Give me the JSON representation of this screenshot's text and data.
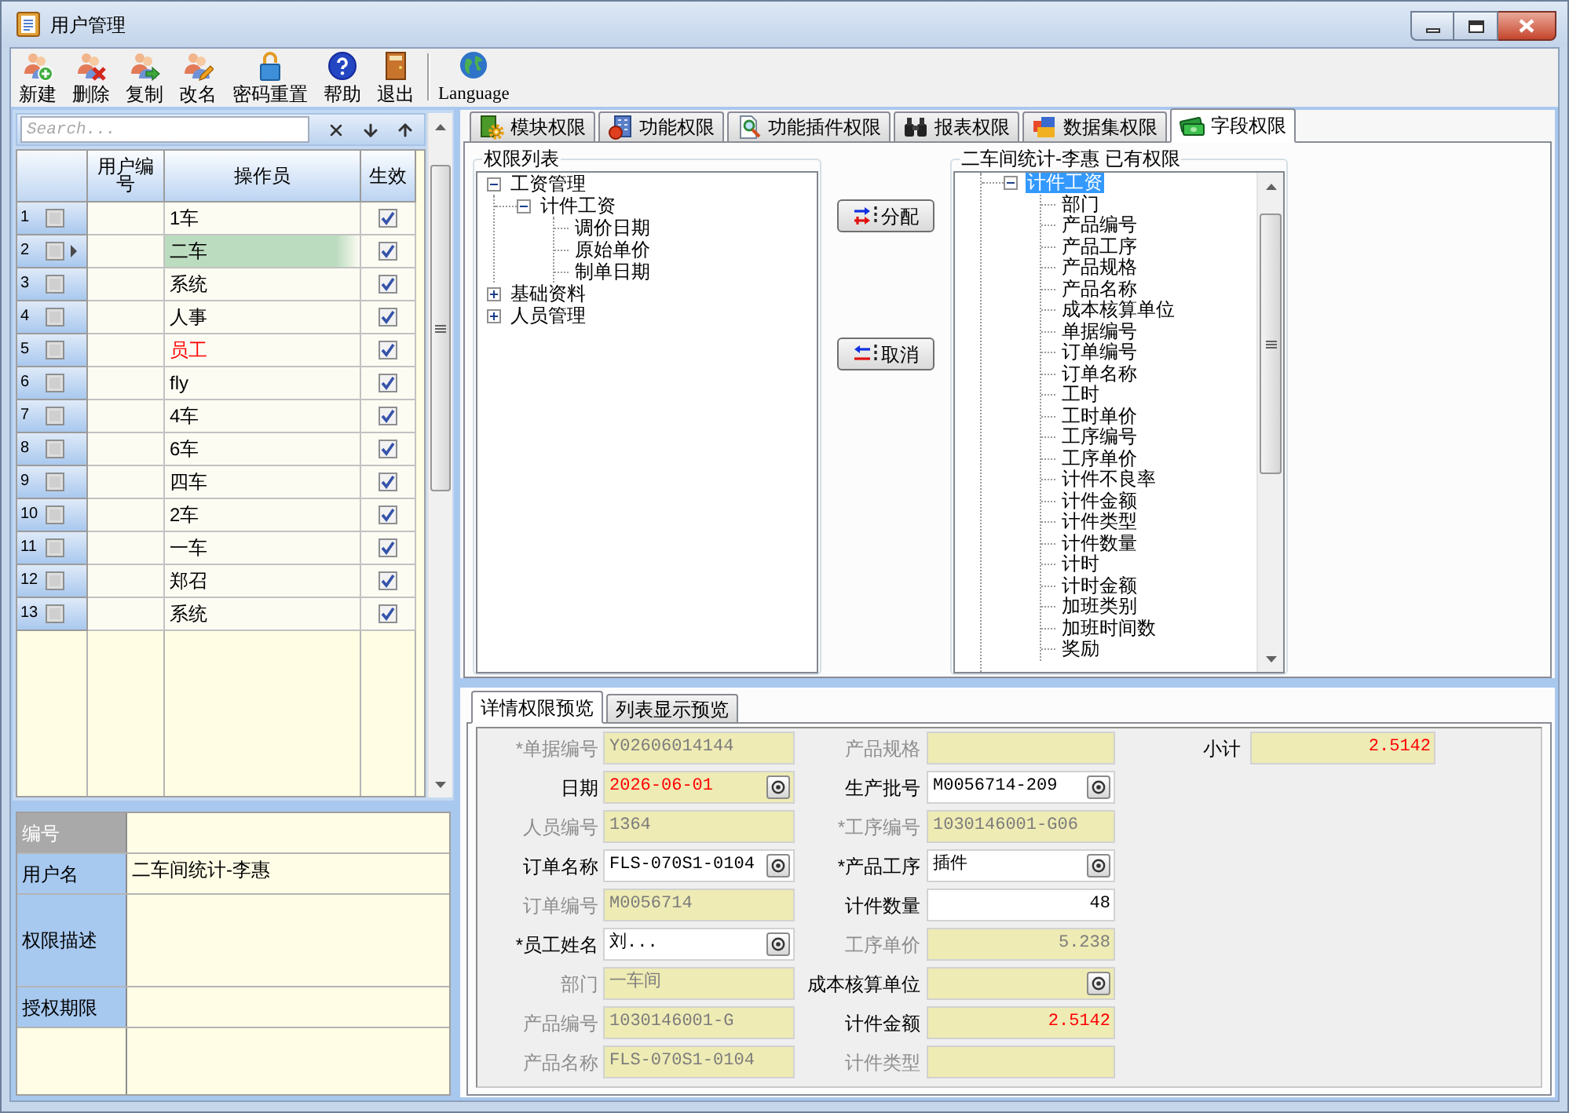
{
  "window": {
    "title": "用户管理"
  },
  "toolbar": {
    "buttons": [
      {
        "label": "新建"
      },
      {
        "label": "删除"
      },
      {
        "label": "复制"
      },
      {
        "label": "改名"
      },
      {
        "label": "密码重置"
      },
      {
        "label": "帮助"
      },
      {
        "label": "退出"
      }
    ],
    "language": {
      "label": "Language"
    }
  },
  "user_list": {
    "search": {
      "placeholder": "Search..."
    },
    "columns": [
      {
        "label": "用户编号"
      },
      {
        "label": "操作员"
      },
      {
        "label": "生效"
      }
    ],
    "rows": [
      {
        "number": "1",
        "checked": false,
        "selected": false,
        "operator": "1车",
        "flagged": false,
        "active": true
      },
      {
        "number": "2",
        "checked": false,
        "selected": true,
        "operator": "二车",
        "flagged": false,
        "active": true
      },
      {
        "number": "3",
        "checked": false,
        "selected": false,
        "operator": "系统",
        "flagged": false,
        "active": true
      },
      {
        "number": "4",
        "checked": false,
        "selected": false,
        "operator": "人事",
        "flagged": false,
        "active": true
      },
      {
        "number": "5",
        "checked": false,
        "selected": false,
        "operator": "员工",
        "flagged": true,
        "active": true
      },
      {
        "number": "6",
        "checked": false,
        "selected": false,
        "operator": "fly",
        "flagged": false,
        "active": true
      },
      {
        "number": "7",
        "checked": false,
        "selected": false,
        "operator": "4车",
        "flagged": false,
        "active": true
      },
      {
        "number": "8",
        "checked": false,
        "selected": false,
        "operator": "6车",
        "flagged": false,
        "active": true
      },
      {
        "number": "9",
        "checked": false,
        "selected": false,
        "operator": "四车",
        "flagged": false,
        "active": true
      },
      {
        "number": "10",
        "checked": false,
        "selected": false,
        "operator": "2车",
        "flagged": false,
        "active": true
      },
      {
        "number": "11",
        "checked": false,
        "selected": false,
        "operator": "一车",
        "flagged": false,
        "active": true
      },
      {
        "number": "12",
        "checked": false,
        "selected": false,
        "operator": "郑召",
        "flagged": false,
        "active": true
      },
      {
        "number": "13",
        "checked": false,
        "selected": false,
        "operator": "系统",
        "flagged": false,
        "active": true
      }
    ]
  },
  "user_details": {
    "fields": [
      {
        "label": "编号",
        "kind": "line",
        "focused": true
      },
      {
        "label": "用户名",
        "kind": "line",
        "value": "二车间统计-李惠",
        "focused": false
      },
      {
        "label": "权限描述",
        "kind": "memo",
        "focused": false
      },
      {
        "label": "授权期限",
        "kind": "line",
        "focused": false
      }
    ]
  },
  "permission_tabs": [
    {
      "label": "模块权限",
      "selected": false
    },
    {
      "label": "功能权限",
      "selected": false
    },
    {
      "label": "功能插件权限",
      "selected": false
    },
    {
      "label": "报表权限",
      "selected": false
    },
    {
      "label": "数据集权限",
      "selected": false
    },
    {
      "label": "字段权限",
      "selected": true
    }
  ],
  "permission_list": {
    "title": "权限列表",
    "tree": [
      {
        "label": "工资管理",
        "expanded": true,
        "selected": false,
        "children": [
          {
            "label": "计件工资",
            "expanded": true,
            "selected": false,
            "children": [
              {
                "label": "调价日期",
                "selected": false
              },
              {
                "label": "原始单价",
                "selected": false
              },
              {
                "label": "制单日期",
                "selected": false
              }
            ]
          }
        ]
      },
      {
        "label": "基础资料",
        "expanded": false,
        "selected": false
      },
      {
        "label": "人员管理",
        "expanded": false,
        "selected": false
      }
    ]
  },
  "transfer_buttons": [
    {
      "label": "分配"
    },
    {
      "label": "取消"
    }
  ],
  "assigned_permissions": {
    "title": "二车间统计-李惠 已有权限",
    "tree": [
      {
        "label": "计件工资",
        "expanded": true,
        "selected": true,
        "children": [
          {
            "label": "部门",
            "selected": false
          },
          {
            "label": "产品编号",
            "selected": false
          },
          {
            "label": "产品工序",
            "selected": false
          },
          {
            "label": "产品规格",
            "selected": false
          },
          {
            "label": "产品名称",
            "selected": false
          },
          {
            "label": "成本核算单位",
            "selected": false
          },
          {
            "label": "单据编号",
            "selected": false
          },
          {
            "label": "订单编号",
            "selected": false
          },
          {
            "label": "订单名称",
            "selected": false
          },
          {
            "label": "工时",
            "selected": false
          },
          {
            "label": "工时单价",
            "selected": false
          },
          {
            "label": "工序编号",
            "selected": false
          },
          {
            "label": "工序单价",
            "selected": false
          },
          {
            "label": "计件不良率",
            "selected": false
          },
          {
            "label": "计件金额",
            "selected": false
          },
          {
            "label": "计件类型",
            "selected": false
          },
          {
            "label": "计件数量",
            "selected": false
          },
          {
            "label": "计时",
            "selected": false
          },
          {
            "label": "计时金额",
            "selected": false
          },
          {
            "label": "加班类别",
            "selected": false
          },
          {
            "label": "加班时间数",
            "selected": false
          },
          {
            "label": "奖励",
            "selected": false
          }
        ]
      }
    ]
  },
  "preview_tabs": [
    {
      "label": "详情权限预览",
      "selected": true
    },
    {
      "label": "列表显示预览",
      "selected": false
    }
  ],
  "preview_form": {
    "columns": [
      [
        {
          "label": "*单据编号",
          "value": "Y02606014144",
          "kind": "text",
          "enabled": false,
          "editable": false,
          "highlighted": false
        },
        {
          "label": "日期",
          "value": "2026-06-01",
          "kind": "lookup",
          "enabled": true,
          "editable": false,
          "highlighted": true
        },
        {
          "label": "人员编号",
          "value": "1364",
          "kind": "text",
          "enabled": false,
          "editable": false,
          "highlighted": false
        },
        {
          "label": "订单名称",
          "value": "FLS-070S1-0104",
          "kind": "lookup",
          "enabled": true,
          "editable": true,
          "highlighted": false
        },
        {
          "label": "订单编号",
          "value": "M0056714",
          "kind": "text",
          "enabled": false,
          "editable": false,
          "highlighted": false
        },
        {
          "label": "*员工姓名",
          "value": "刘...",
          "kind": "lookup",
          "enabled": true,
          "editable": true,
          "highlighted": false
        },
        {
          "label": "部门",
          "value": "一车间",
          "kind": "text",
          "enabled": false,
          "editable": false,
          "highlighted": false
        },
        {
          "label": "产品编号",
          "value": "1030146001-G",
          "kind": "text",
          "enabled": false,
          "editable": false,
          "highlighted": false
        },
        {
          "label": "产品名称",
          "value": "FLS-070S1-0104",
          "kind": "text",
          "enabled": false,
          "editable": false,
          "highlighted": false
        }
      ],
      [
        {
          "label": "产品规格",
          "kind": "text",
          "enabled": false,
          "editable": false
        },
        {
          "label": "生产批号",
          "value": "M0056714-209",
          "kind": "lookup",
          "enabled": true,
          "editable": true,
          "highlighted": false
        },
        {
          "label": "*工序编号",
          "value": "1030146001-G06",
          "kind": "text",
          "enabled": false,
          "editable": false,
          "highlighted": false
        },
        {
          "label": "*产品工序",
          "value": "插件",
          "kind": "lookup",
          "enabled": true,
          "editable": true,
          "highlighted": false
        },
        {
          "label": "计件数量",
          "value": "48",
          "kind": "number",
          "enabled": true,
          "editable": true,
          "highlighted": false
        },
        {
          "label": "工序单价",
          "value": "5.238",
          "kind": "number",
          "enabled": false,
          "editable": false,
          "highlighted": false
        },
        {
          "label": "成本核算单位",
          "kind": "lookup",
          "enabled": true,
          "editable": false
        },
        {
          "label": "计件金额",
          "value": "2.5142",
          "kind": "number",
          "enabled": true,
          "editable": false,
          "highlighted": true
        },
        {
          "label": "计件类型",
          "kind": "text",
          "enabled": false,
          "editable": false
        }
      ],
      [
        {
          "label": "小计",
          "value": "2.5142",
          "kind": "number",
          "enabled": true,
          "editable": false,
          "highlighted": true
        }
      ]
    ]
  }
}
